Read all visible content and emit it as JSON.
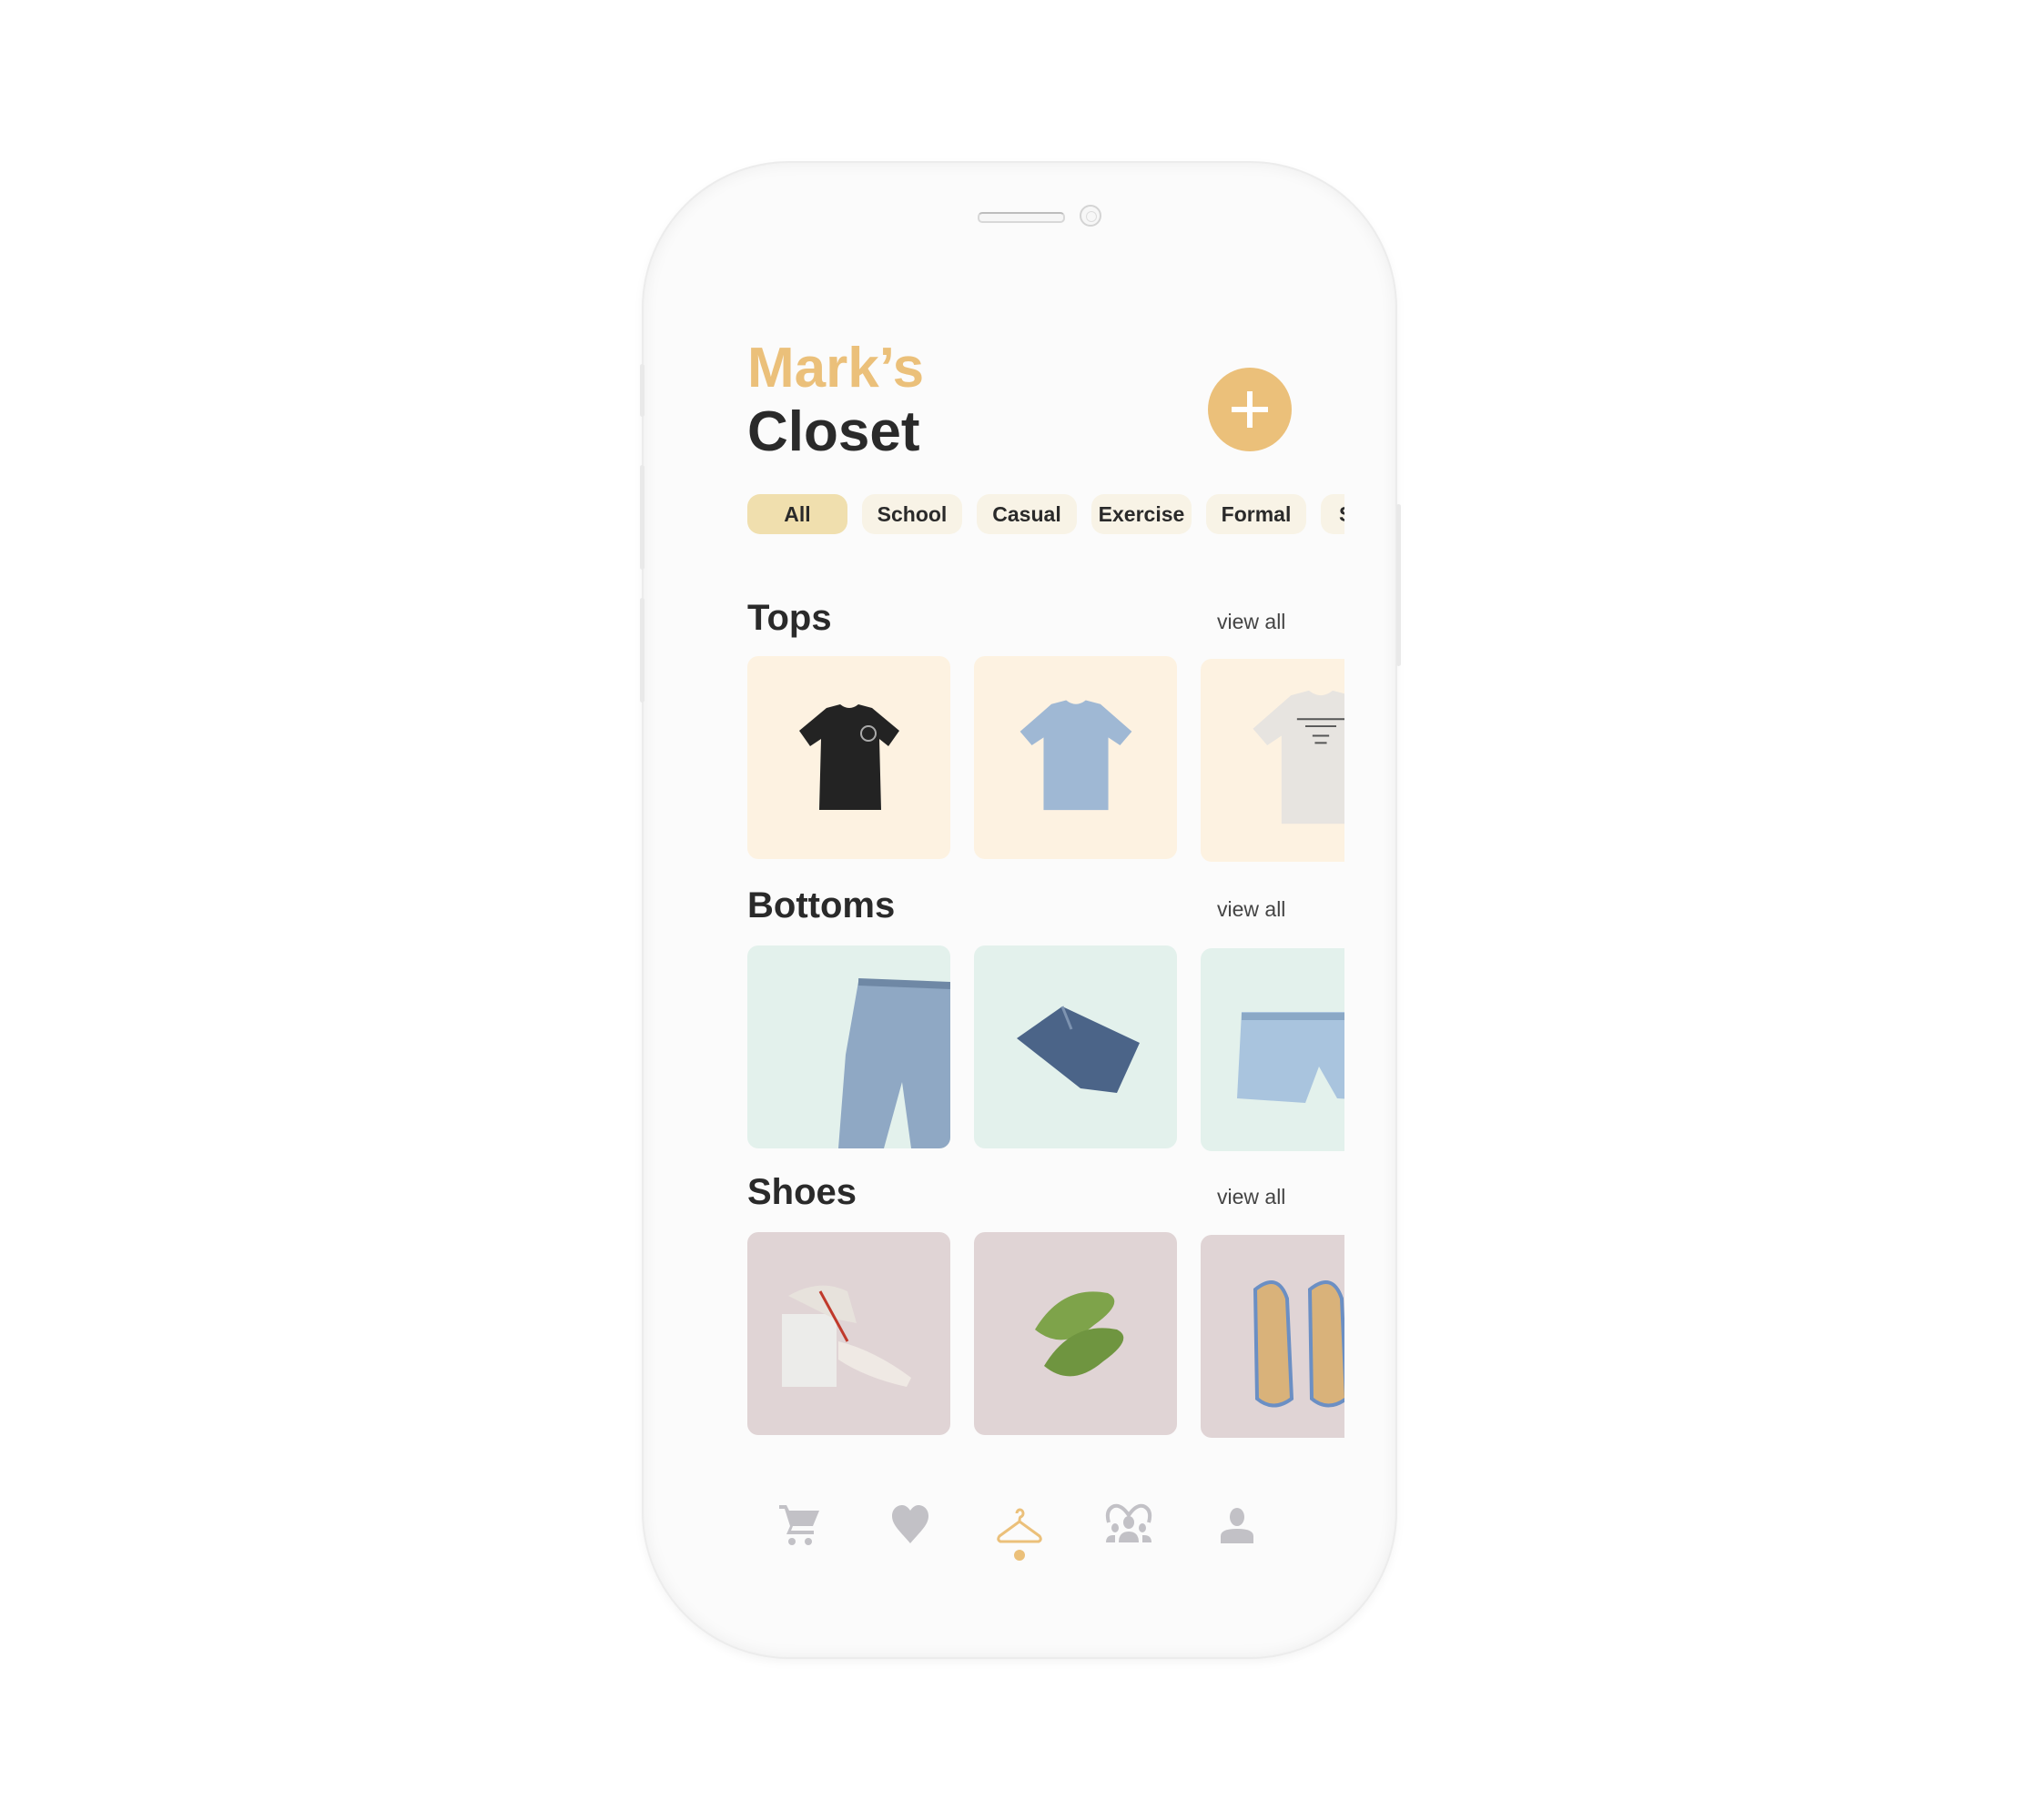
{
  "header": {
    "title_line1": "Mark’s",
    "title_line2": "Closet",
    "add_icon": "plus-icon"
  },
  "filters": [
    {
      "label": "All",
      "active": true
    },
    {
      "label": "School",
      "active": false
    },
    {
      "label": "Casual",
      "active": false
    },
    {
      "label": "Exercise",
      "active": false
    },
    {
      "label": "Formal",
      "active": false
    },
    {
      "label": "S",
      "active": false
    }
  ],
  "sections": {
    "tops": {
      "title": "Tops",
      "view_all": "view all"
    },
    "bottoms": {
      "title": "Bottoms",
      "view_all": "view all"
    },
    "shoes": {
      "title": "Shoes",
      "view_all": "view all"
    }
  },
  "nav": [
    {
      "icon": "cart-icon",
      "active": false
    },
    {
      "icon": "heart-icon",
      "active": false
    },
    {
      "icon": "hanger-icon",
      "active": true
    },
    {
      "icon": "community-icon",
      "active": false
    },
    {
      "icon": "profile-icon",
      "active": false
    }
  ],
  "colors": {
    "accent": "#EBC07A",
    "chip_active": "#F0DFAE",
    "chip": "#F8F3E6",
    "tops_bg": "#FDF2E1",
    "bottoms_bg": "#E3F1EC",
    "shoes_bg": "#E0D4D5",
    "icon_inactive": "#C2C1C6",
    "text": "#2A2A2A"
  }
}
